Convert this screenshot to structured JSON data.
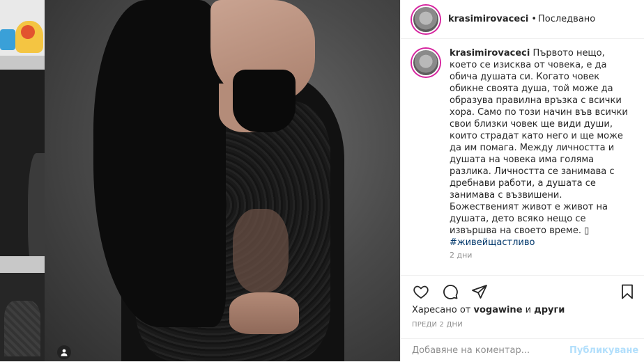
{
  "header": {
    "username": "krasimirovaceci",
    "dot": "•",
    "follow_label": "Последвано"
  },
  "caption": {
    "username": "krasimirovaceci",
    "text": "Първото нещо, което се изисква от човека, е да обича душата си. Когато човек обикне своята душа, той може да образува правилна връзка с всички хора. Само по този начин във всички свои близки човек ще види души, които страдат като него и ще може да им помага. Между личността и душата на човека има голяма разлика. Личността се занимава с дребнави работи, а душата се занимава с възвишени. Божественият живот е живот на душата, дето всяко нещо се извършва на своето време. ▯",
    "hashtag": "#живейщастливо",
    "time": "2 дни"
  },
  "actions": {
    "like_icon": "heart-icon",
    "comment_icon": "comment-icon",
    "share_icon": "share-icon",
    "save_icon": "bookmark-icon"
  },
  "likes": {
    "prefix": "Харесано от ",
    "user": "vogawine",
    "middle": " и ",
    "others": "други"
  },
  "date": "ПРЕДИ 2 ДНИ",
  "comment": {
    "placeholder": "Добавяне на коментар...",
    "post_label": "Публикуване"
  },
  "colors": {
    "link": "#00376b",
    "post_disabled": "#b2dffc",
    "secondary_text": "#8e8e8e",
    "avatar_ring": "#d6249f"
  }
}
